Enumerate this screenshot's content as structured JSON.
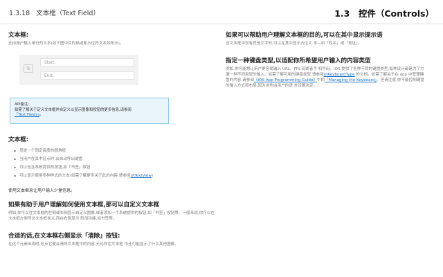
{
  "header": {
    "section_number": "1.3.18",
    "section_title": "文本框（Text Field）",
    "chapter": "1.3　控件（Controls）"
  },
  "left": {
    "intro": {
      "title": "文本框:",
      "text": "支持用户输入单行的文本(如下图中目的描述和占位符文本如所示)。"
    },
    "demo": {
      "field1": "Start:",
      "field2": "End:"
    },
    "note": {
      "title": "API备注:",
      "text_before": "如需了解关于定义文本框并自定义以显示图像和按钮的更多信息,请参阅",
      "link": "「Text Fields」",
      "text_after": "。"
    },
    "features": {
      "title": "文本框:",
      "items": [
        "显是一个固定高度的圆角框",
        "当用户在其中轻点时,会自动呼出键盘",
        "可以包含系统提供的按钮,如「书签」按钮",
        "可以显示使用多种样式的文本(如需了解更多关于此的内容,请参阅"
      ],
      "item4_link": "UITextView",
      "item4_end": ")"
    },
    "summary": "使用文本框来让用户输入少量信息。",
    "custom": {
      "title": "如果有助于用户理解如何使用文本框,那可以自定义文本框",
      "text": "例如,你可以在文本框的左侧或右侧显示自定义图像,或者添加一个系统提供的按钮,如「书签」按钮等。一般来说,你可以在文本框左侧传达文本框含义,而在右侧显示 附加功能,如书签等。"
    },
    "clear": {
      "title": "合适的话,在文本框右侧显示「清除」按钮:",
      "text": "在这个元素出现时,轻点它便会清除文本框中的内容,无论你在文本框 中还可能显示了什么其他图像。"
    }
  },
  "right": {
    "hint": {
      "title": "如果可以帮助用户理解文本框的目的,可以在其中显示提示语",
      "text": "当文本框中没有其他文字时,可以在其中显示占位文 本—如「姓名」或「地址」。"
    },
    "keyboard": {
      "title": "指定一种键盘类型,以适配你所希望用户输入的内容类型",
      "text1": "例如,你可能想让用户更容易输入 URL、PIN 码或者手 机号码。iOS 提供了各种不同的键盘类型,每种设计都是为了方便一种不同类型的输入。如需了解可用的键盘类型,请参阅",
      "link1": "UIKeyboardType",
      "text2": " 的文档。如需了解关于在 app 中管理键盘的内容,请参阅",
      "link2": "《iOS App Programming Guide》",
      "text3": "中的",
      "link3": "「Managing the Keyboard」",
      "text4": "。但请注意,你不能控制键盘的输入方式和布局,因为这些由用户的语 言设置决定。"
    }
  }
}
